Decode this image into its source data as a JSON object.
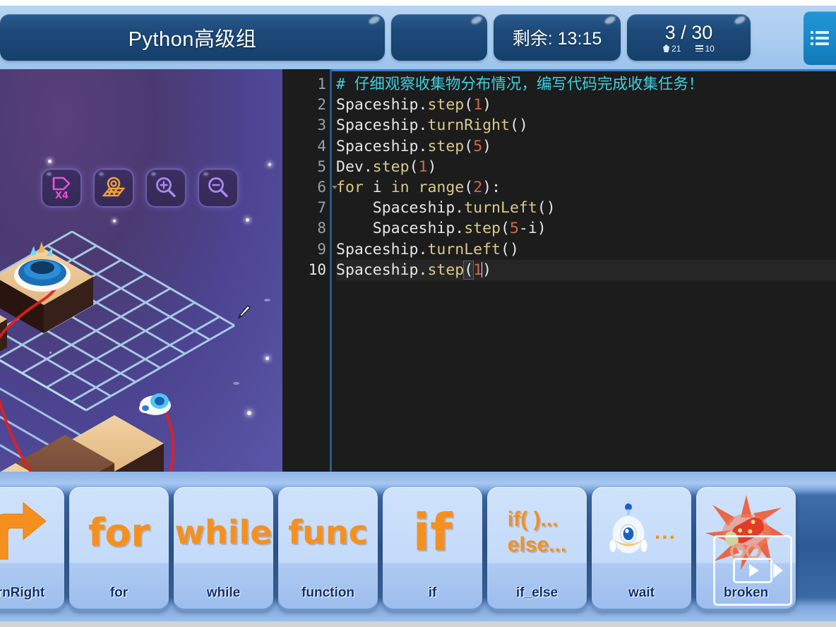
{
  "header": {
    "title": "Python高级组",
    "blank_tab": "",
    "timer_label": "剩余: 13:15",
    "progress": "3 / 30",
    "gem_count": "21",
    "lines_count": "10",
    "menu_icon": "list-menu-icon"
  },
  "game": {
    "tools": [
      {
        "name": "speed-x4-icon",
        "label": "x4"
      },
      {
        "name": "map-icon",
        "label": "map"
      },
      {
        "name": "zoom-in-icon",
        "label": "+"
      },
      {
        "name": "zoom-out-icon",
        "label": "-"
      }
    ],
    "cursor": "pencil-cursor"
  },
  "editor": {
    "line_numbers": [
      "1",
      "2",
      "3",
      "4",
      "5",
      "6",
      "7",
      "8",
      "9",
      "10"
    ],
    "active_line": 10,
    "fold_line": 6,
    "lines": [
      {
        "n": 1,
        "tokens": [
          {
            "t": "# 仔细观察收集物分布情况，编写代码完成收集任务！",
            "c": "comment"
          }
        ]
      },
      {
        "n": 2,
        "tokens": [
          {
            "t": "Spaceship.",
            "c": "plain"
          },
          {
            "t": "step",
            "c": "fn"
          },
          {
            "t": "(",
            "c": "plain"
          },
          {
            "t": "1",
            "c": "num"
          },
          {
            "t": ")",
            "c": "plain"
          }
        ]
      },
      {
        "n": 3,
        "tokens": [
          {
            "t": "Spaceship.",
            "c": "plain"
          },
          {
            "t": "turnRight",
            "c": "fn"
          },
          {
            "t": "()",
            "c": "plain"
          }
        ]
      },
      {
        "n": 4,
        "tokens": [
          {
            "t": "Spaceship.",
            "c": "plain"
          },
          {
            "t": "step",
            "c": "fn"
          },
          {
            "t": "(",
            "c": "plain"
          },
          {
            "t": "5",
            "c": "num"
          },
          {
            "t": ")",
            "c": "plain"
          }
        ]
      },
      {
        "n": 5,
        "tokens": [
          {
            "t": "Dev.",
            "c": "plain"
          },
          {
            "t": "step",
            "c": "fn"
          },
          {
            "t": "(",
            "c": "plain"
          },
          {
            "t": "1",
            "c": "num"
          },
          {
            "t": ")",
            "c": "plain"
          }
        ]
      },
      {
        "n": 6,
        "tokens": [
          {
            "t": "for",
            "c": "kw"
          },
          {
            "t": " i ",
            "c": "plain"
          },
          {
            "t": "in",
            "c": "kw"
          },
          {
            "t": " ",
            "c": "plain"
          },
          {
            "t": "range",
            "c": "fn"
          },
          {
            "t": "(",
            "c": "plain"
          },
          {
            "t": "2",
            "c": "num"
          },
          {
            "t": "):",
            "c": "plain"
          }
        ]
      },
      {
        "n": 7,
        "tokens": [
          {
            "t": "    Spaceship.",
            "c": "plain"
          },
          {
            "t": "turnLeft",
            "c": "fn"
          },
          {
            "t": "()",
            "c": "plain"
          }
        ]
      },
      {
        "n": 8,
        "tokens": [
          {
            "t": "    Spaceship.",
            "c": "plain"
          },
          {
            "t": "step",
            "c": "fn"
          },
          {
            "t": "(",
            "c": "plain"
          },
          {
            "t": "5",
            "c": "num"
          },
          {
            "t": "-i",
            "c": "plain"
          },
          {
            "t": ")",
            "c": "plain"
          }
        ]
      },
      {
        "n": 9,
        "tokens": [
          {
            "t": "Spaceship.",
            "c": "plain"
          },
          {
            "t": "turnLeft",
            "c": "fn"
          },
          {
            "t": "()",
            "c": "plain"
          }
        ]
      },
      {
        "n": 10,
        "tokens": [
          {
            "t": "Spaceship.",
            "c": "plain"
          },
          {
            "t": "step",
            "c": "fn"
          },
          {
            "t": "(",
            "c": "bracket"
          },
          {
            "t": "1",
            "c": "num"
          },
          {
            "t": ")",
            "c": "plain"
          }
        ]
      }
    ],
    "code_text": "# 仔细观察收集物分布情况，编写代码完成收集任务！\nSpaceship.step(1)\nSpaceship.turnRight()\nSpaceship.step(5)\nDev.step(1)\nfor i in range(2):\n    Spaceship.turnLeft()\n    Spaceship.step(5-i)\nSpaceship.turnLeft()\nSpaceship.step(1)"
  },
  "toolbar": {
    "blocks": [
      {
        "label": "turnRight",
        "art": "arrow-right-turn",
        "art_text": ""
      },
      {
        "label": "for",
        "art": "keyword",
        "art_text": "for"
      },
      {
        "label": "while",
        "art": "keyword",
        "art_text": "while"
      },
      {
        "label": "function",
        "art": "keyword",
        "art_text": "func"
      },
      {
        "label": "if",
        "art": "keyword-big",
        "art_text": "if"
      },
      {
        "label": "if_else",
        "art": "if-else",
        "art_text": "if( )...\nelse..."
      },
      {
        "label": "wait",
        "art": "robot",
        "art_text": "..."
      },
      {
        "label": "broken",
        "art": "broken-burst",
        "art_text": ""
      }
    ],
    "video_overlay_icon": "video-play-icon"
  },
  "colors": {
    "header_bg": "#aacdf0",
    "tab_bg": "#1d4a79",
    "menu_accent": "#1887c7",
    "editor_bg": "#1c1c1c",
    "comment": "#3fd0e0",
    "function": "#d9c98a",
    "number": "#cf6a4c",
    "toolbar_bg": "#2e5b95",
    "block_bg": "#c3dafa",
    "block_accent": "#f5901f",
    "game_bg": "#4c4491"
  }
}
